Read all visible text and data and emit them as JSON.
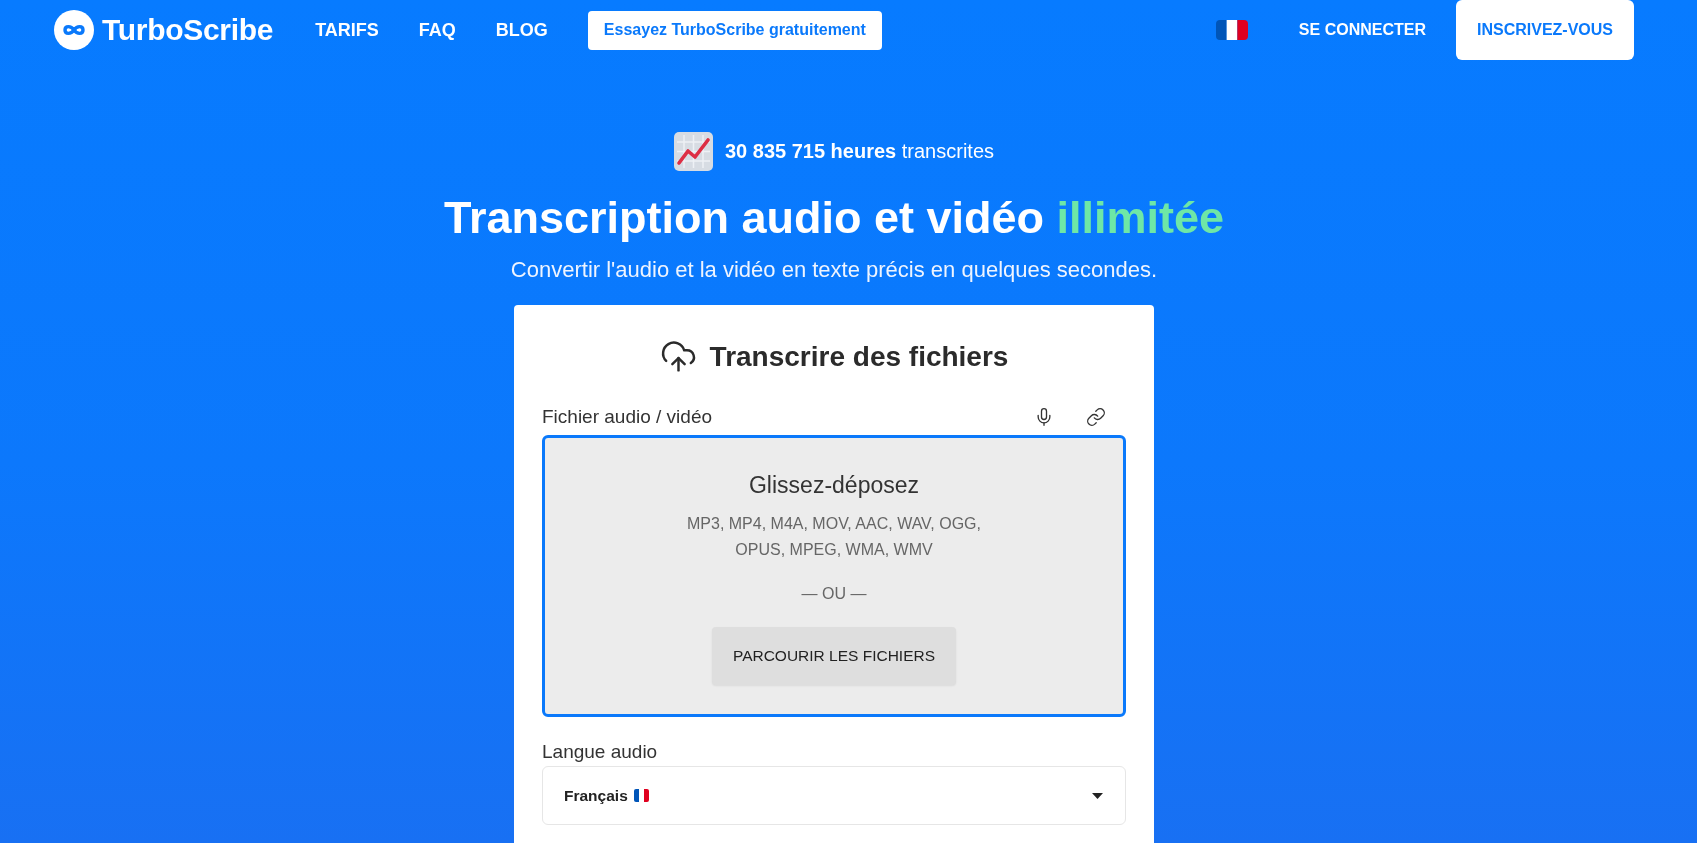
{
  "header": {
    "logo": "TurboScribe",
    "nav": [
      {
        "label": "TARIFS"
      },
      {
        "label": "FAQ"
      },
      {
        "label": "BLOG"
      }
    ],
    "trial_button": "Essayez TurboScribe gratuitement",
    "sign_in": "SE CONNECTER",
    "sign_up": "INSCRIVEZ-VOUS"
  },
  "hero": {
    "stat": "**30 835 715 heures** transcrites",
    "title": "Transcription audio et vidéo",
    "title_highlight": "illimitée",
    "subtitle": "Convertir l'audio et la vidéo en texte précis en quelques secondes."
  },
  "upload_card": {
    "title": "Transcrire des fichiers",
    "file_label": "Fichier audio / vidéo",
    "dropzone": {
      "heading": "Glissez-déposez",
      "formats": "MP3, MP4, M4A, MOV, AAC, WAV, OGG, OPUS, MPEG, WMA, WMV",
      "separator": "— OU —",
      "browse_button": "PARCOURIR LES FICHIERS"
    },
    "language": {
      "label": "Langue audio",
      "value": "Français"
    }
  }
}
